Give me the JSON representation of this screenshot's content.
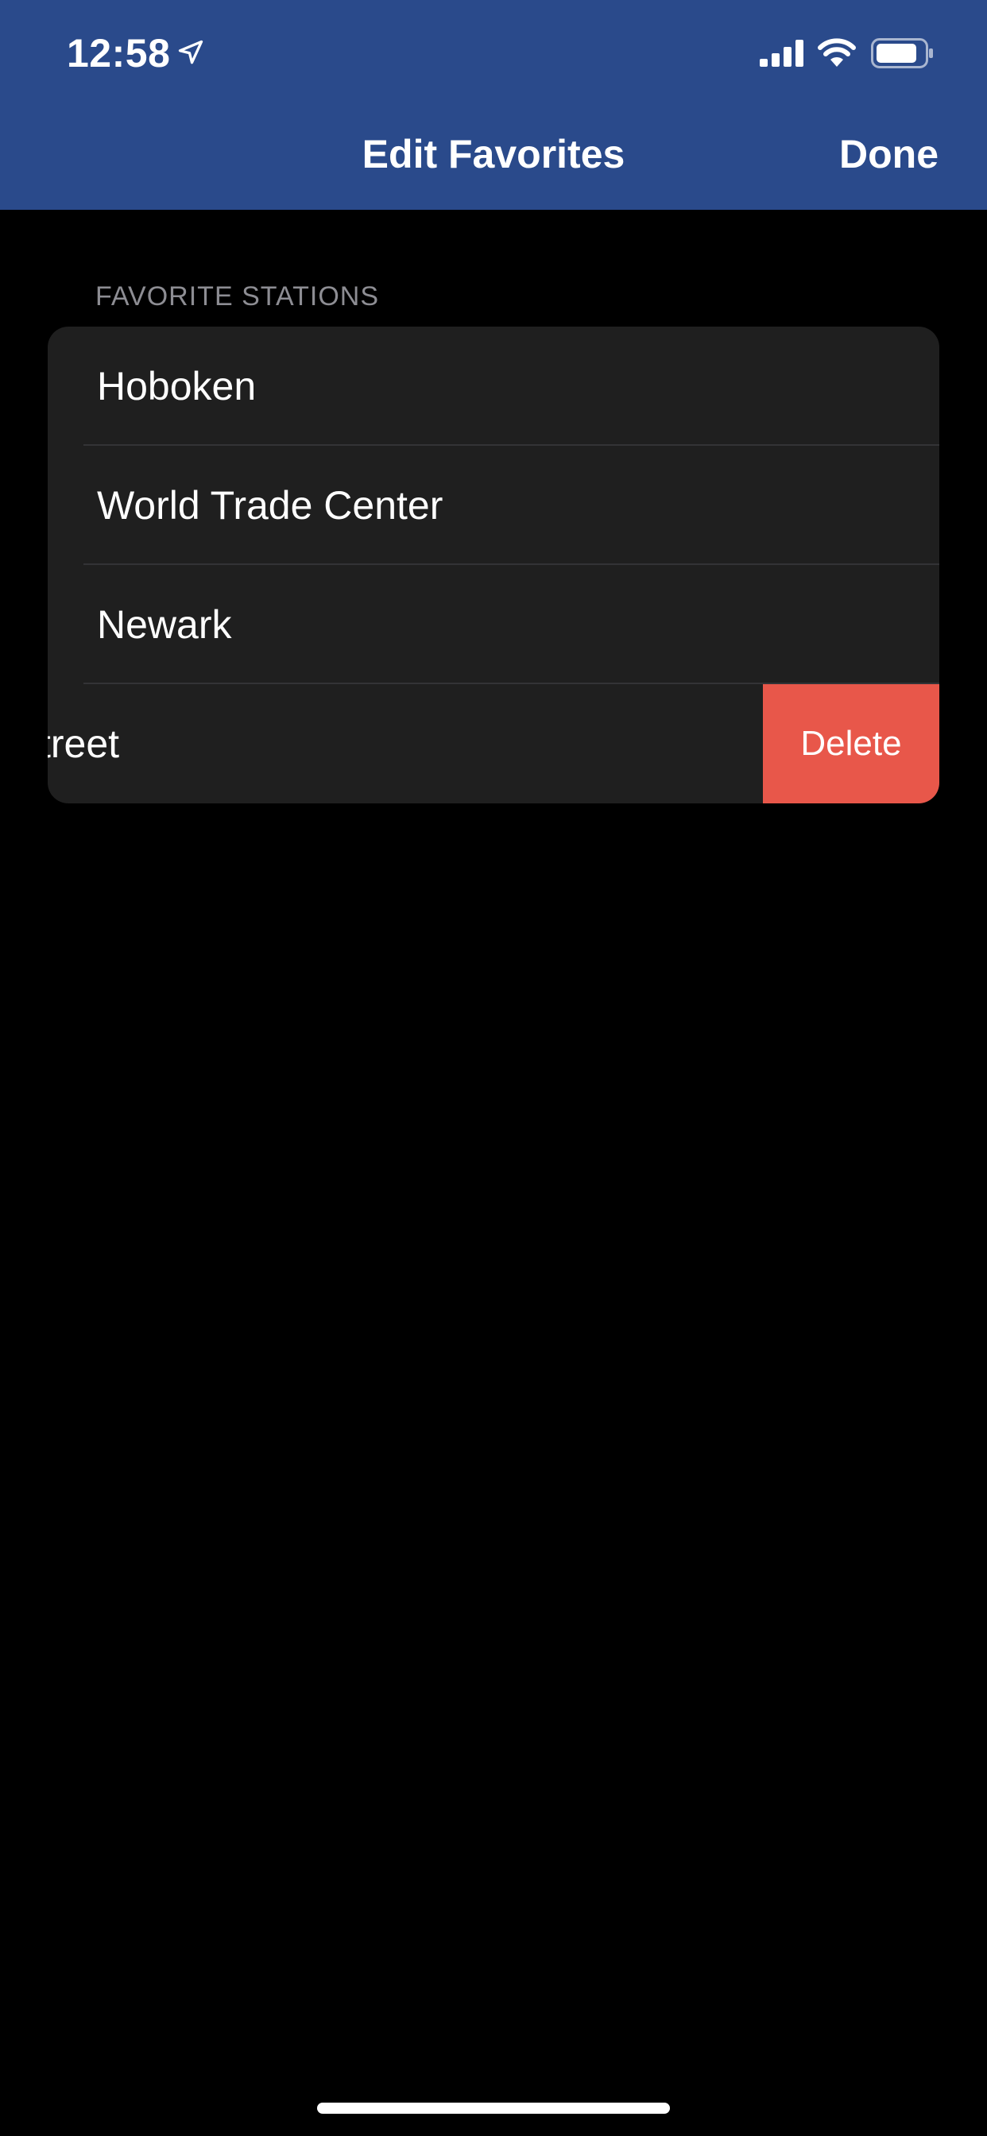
{
  "status_bar": {
    "time": "12:58",
    "icons": [
      "location-arrow-icon",
      "cellular-signal-icon",
      "wifi-icon",
      "battery-icon"
    ]
  },
  "nav": {
    "title": "Edit Favorites",
    "done_label": "Done"
  },
  "section": {
    "header": "FAVORITE STATIONS"
  },
  "favorites": {
    "items": [
      {
        "label": "Hoboken"
      },
      {
        "label": "World Trade Center"
      },
      {
        "label": "Newark"
      },
      {
        "label": "treet",
        "swiped": true
      }
    ],
    "delete_label": "Delete"
  },
  "colors": {
    "header_bg": "#2a4a8b",
    "page_bg": "#000000",
    "card_bg": "#1f1f1f",
    "delete_bg": "#e8574a",
    "section_text": "#8d8d93"
  }
}
